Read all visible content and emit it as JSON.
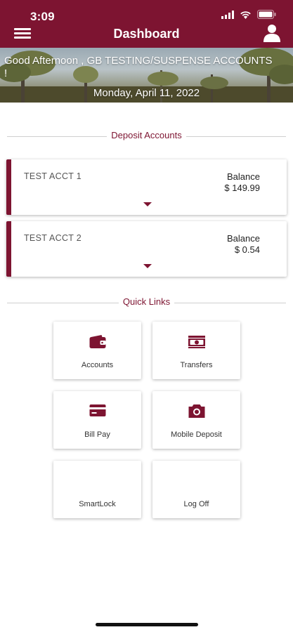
{
  "status": {
    "time": "3:09"
  },
  "header": {
    "title": "Dashboard"
  },
  "banner": {
    "greeting": "Good Afternoon , GB TESTING/SUSPENSE ACCOUNTS",
    "greeting_wrap": "!",
    "date": "Monday, April 11, 2022"
  },
  "deposit_section": {
    "label": "Deposit Accounts"
  },
  "accounts": [
    {
      "name": "TEST ACCT 1",
      "balance_label": "Balance",
      "balance": "$ 149.99"
    },
    {
      "name": "TEST ACCT 2",
      "balance_label": "Balance",
      "balance": "$ 0.54"
    }
  ],
  "quick_section": {
    "label": "Quick Links"
  },
  "quick_links": [
    {
      "label": "Accounts",
      "icon": "wallet-icon"
    },
    {
      "label": "Transfers",
      "icon": "money-icon"
    },
    {
      "label": "Bill Pay",
      "icon": "credit-card-icon"
    },
    {
      "label": "Mobile Deposit",
      "icon": "camera-icon"
    },
    {
      "label": "SmartLock",
      "icon": ""
    },
    {
      "label": "Log Off",
      "icon": ""
    }
  ],
  "colors": {
    "brand": "#7d1431"
  }
}
